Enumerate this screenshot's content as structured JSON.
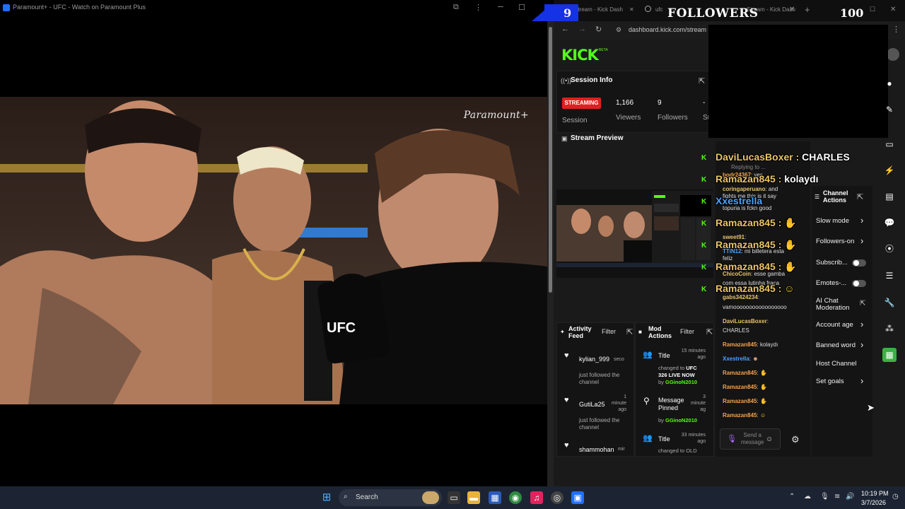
{
  "left_window": {
    "title": "Paramount+ - UFC - Watch on Paramount Plus",
    "watermark": "Paramount+",
    "mic_flag": "UFC"
  },
  "browser": {
    "tabs": [
      {
        "label": "Stream - Kick Dash"
      },
      {
        "label": "ufc"
      },
      {
        "label": "Stream - Kick Dash"
      }
    ],
    "url": "dashboard.kick.com/stream"
  },
  "overlay": {
    "follower_count": "9",
    "followers_label": "FOLLOWERS",
    "follower_goal": "100"
  },
  "kick": {
    "logo": "KICK",
    "beta": "BETA",
    "session": {
      "title": "Session Info",
      "status": "STREAMING",
      "status_label": "Session",
      "viewers_value": "1,166",
      "viewers_label": "Viewers",
      "followers_value": "9",
      "followers_label": "Followers",
      "subs_value": "-",
      "subs_label": "Su"
    },
    "preview": {
      "title": "Stream Preview"
    },
    "activity": {
      "title_line1": "Activity",
      "title_line2": "Feed",
      "filter": "Filter",
      "items": [
        {
          "name": "kylian_999",
          "time": "seco",
          "desc_line1": "just followed the",
          "desc_line2": "channel"
        },
        {
          "name": "GutiLa25",
          "time_line1": "1",
          "time_line2": "minute",
          "time_line3": "ago",
          "desc_line1": "just followed the",
          "desc_line2": "channel"
        },
        {
          "name": "shammohan",
          "time": "mir"
        }
      ]
    },
    "mod_actions": {
      "title_line1": "Mod",
      "title_line2": "Actions",
      "filter": "Filter",
      "items": [
        {
          "title": "Title",
          "time_line1": "15 minutes",
          "time_line2": "ago",
          "desc_line1": "changed to",
          "desc_strong": "UFC",
          "desc_line2": "326 LIVE NOW",
          "by": "by",
          "user": "GGinoN2010"
        },
        {
          "title_line1": "Message",
          "title_line2": "Pinned",
          "time_line1": "3",
          "time_line2": "minute",
          "time_line3": "ag",
          "by": "by",
          "user": "GGinoN2010"
        },
        {
          "title": "Title",
          "time_line1": "33 minutes",
          "time_line2": "ago",
          "desc_line1": "changed to OLD"
        }
      ]
    },
    "chat": {
      "replying": "Replying to ...",
      "messages": [
        {
          "user": "bodr24367",
          "text": "yes"
        },
        {
          "user": "coringaperuano",
          "text": "and"
        },
        {
          "text": "fights me this is it say"
        },
        {
          "text": "topuria is fckn good"
        },
        {
          "user": "sweet91",
          "text": ""
        },
        {
          "user": "TTiN12",
          "text": "mi billetera esta"
        },
        {
          "text": "feliz"
        },
        {
          "user": "ChicoCoin",
          "text": "esse gamba"
        },
        {
          "text": "com essa lutinha fraca"
        },
        {
          "user": "gabs3424234",
          "text": ""
        },
        {
          "text": "vamooooooooooooooooo"
        },
        {
          "user": "DaviLucasBoxer",
          "text": ""
        },
        {
          "text": "CHARLES"
        },
        {
          "user": "Ramazan845",
          "text": "kolaydı"
        },
        {
          "user": "Xxestrella",
          "text": ""
        },
        {
          "user": "Ramazan845",
          "text": ""
        },
        {
          "user": "Ramazan845",
          "text": ""
        },
        {
          "user": "Ramazan845",
          "text": ""
        },
        {
          "user": "Ramazan845",
          "text": ""
        }
      ],
      "input_placeholder_line1": "Send a",
      "input_placeholder_line2": "message"
    },
    "big_chat": [
      {
        "user": "DaviLucasBoxer",
        "text": "CHARLES"
      },
      {
        "user": "Ramazan845",
        "text": "kolaydı"
      },
      {
        "user": "Xxestrella",
        "text": ""
      },
      {
        "user": "Ramazan845",
        "text": ""
      },
      {
        "user": "Ramazan845",
        "text": ""
      },
      {
        "user": "Ramazan845",
        "text": ""
      },
      {
        "user": "Ramazan845",
        "text": ""
      }
    ],
    "channel_actions": {
      "title_line1": "Channel",
      "title_line2": "Actions",
      "items": [
        {
          "label": "Slow mode",
          "kind": "chevron"
        },
        {
          "label": "Followers-on",
          "kind": "chevron"
        },
        {
          "label": "Subscrib...",
          "kind": "toggle"
        },
        {
          "label": "Emotes-...",
          "kind": "toggle"
        },
        {
          "label_line1": "AI Chat",
          "label_line2": "Moderation",
          "kind": "external"
        },
        {
          "label": "Account age",
          "kind": "chevron"
        },
        {
          "label": "Banned word",
          "kind": "chevron"
        },
        {
          "label": "Host Channel",
          "kind": "none"
        },
        {
          "label": "Set goals",
          "kind": "chevron"
        }
      ]
    }
  },
  "taskbar": {
    "search": "Search",
    "time": "10:19 PM",
    "date": "3/7/2026"
  },
  "colors": {
    "kick_green": "#53fc18",
    "streaming_red": "#e0201c",
    "overlay_blue": "#1532e6",
    "chat_name_gold": "#e9c46a"
  }
}
